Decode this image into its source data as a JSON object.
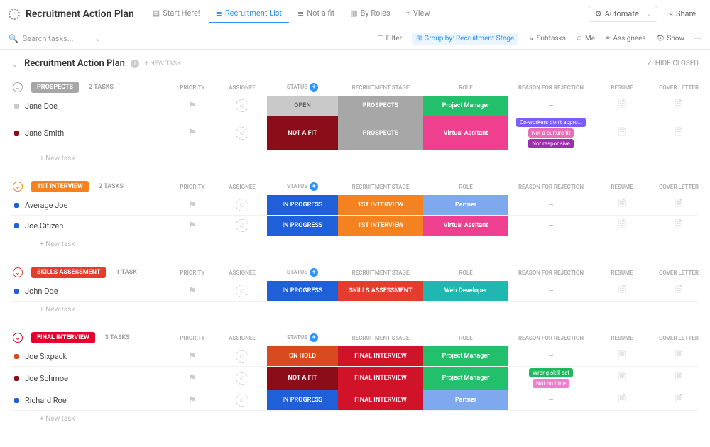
{
  "header": {
    "page_title": "Recruitment Action Plan",
    "views": [
      {
        "label": "Start Here!",
        "icon": "▤",
        "active": false
      },
      {
        "label": "Recruitment List",
        "icon": "≣",
        "active": true
      },
      {
        "label": "Not a fit",
        "icon": "≣",
        "active": false
      },
      {
        "label": "By Roles",
        "icon": "▥",
        "active": false
      },
      {
        "label": "View",
        "icon": "+",
        "active": false
      }
    ],
    "automate": "Automate",
    "share": "Share"
  },
  "toolbar": {
    "search_placeholder": "Search tasks...",
    "filter": "Filter",
    "group_by": "Group by: Recruitment Stage",
    "subtasks": "Subtasks",
    "me": "Me",
    "assignees": "Assignees",
    "show": "Show"
  },
  "list": {
    "title": "Recruitment Action Plan",
    "new_task": "+ NEW TASK",
    "hide_closed": "HIDE CLOSED"
  },
  "columns": {
    "priority": "PRIORITY",
    "assignee": "ASSIGNEE",
    "status": "STATUS",
    "stage": "RECRUITMENT STAGE",
    "role": "ROLE",
    "reason": "REASON FOR REJECTION",
    "resume": "RESUME",
    "cover": "COVER LETTER"
  },
  "colors": {
    "prospects": "#a7a7a7",
    "interview1": "#f58220",
    "skills": "#e43c2f",
    "final": "#e4002b",
    "open_bg": "#c9c9c9",
    "open_text": "#5c5c5c",
    "notfit": "#8c0d1a",
    "prospects_cell": "#a7a7a7",
    "pm": "#22c06b",
    "va": "#ef3f8f",
    "partner": "#7fa9ef",
    "webdev": "#1fb8b0",
    "inprogress": "#1f5fd8",
    "onhold": "#d84a1f",
    "interview1_cell": "#f58220",
    "skills_cell": "#e43c2f",
    "final_cell": "#d1132a",
    "tag_purple": "#7c5cff",
    "tag_pink": "#e86fb5",
    "tag_magenta": "#9b2fae",
    "tag_green": "#1fb85f",
    "tag_pink2": "#f27ed0"
  },
  "groups": [
    {
      "name": "PROSPECTS",
      "color_key": "prospects",
      "collapse_color": "#a7a7a7",
      "count": "2 TASKS",
      "tasks": [
        {
          "name": "Jane Doe",
          "dot": "#c9c9c9",
          "status": {
            "label": "OPEN",
            "bg": "open_bg",
            "text": "open_text"
          },
          "stage": {
            "label": "PROSPECTS",
            "bg": "prospects_cell"
          },
          "role": {
            "label": "Project Manager",
            "bg": "pm"
          },
          "reason": "dash"
        },
        {
          "name": "Jane Smith",
          "dot": "#8c0d1a",
          "status": {
            "label": "NOT A FIT",
            "bg": "notfit"
          },
          "stage": {
            "label": "PROSPECTS",
            "bg": "prospects_cell"
          },
          "role": {
            "label": "Virtual Assitant",
            "bg": "va"
          },
          "reason": [
            {
              "label": "Co-workers don't appro...",
              "c": "tag_purple"
            },
            {
              "label": "Not a culture fit",
              "c": "tag_pink"
            },
            {
              "label": "Not responsive",
              "c": "tag_magenta"
            }
          ]
        }
      ]
    },
    {
      "name": "1ST INTERVIEW",
      "color_key": "interview1",
      "collapse_color": "#f58220",
      "count": "2 TASKS",
      "tasks": [
        {
          "name": "Average Joe",
          "dot": "#1f5fd8",
          "status": {
            "label": "IN PROGRESS",
            "bg": "inprogress"
          },
          "stage": {
            "label": "1ST INTERVIEW",
            "bg": "interview1_cell"
          },
          "role": {
            "label": "Partner",
            "bg": "partner"
          },
          "reason": "dash"
        },
        {
          "name": "Joe Citizen",
          "dot": "#1f5fd8",
          "status": {
            "label": "IN PROGRESS",
            "bg": "inprogress"
          },
          "stage": {
            "label": "1ST INTERVIEW",
            "bg": "interview1_cell"
          },
          "role": {
            "label": "Virtual Assitant",
            "bg": "va"
          },
          "reason": "dash"
        }
      ]
    },
    {
      "name": "SKILLS ASSESSMENT",
      "color_key": "skills",
      "collapse_color": "#e43c2f",
      "count": "1 TASK",
      "tasks": [
        {
          "name": "John Doe",
          "dot": "#1f5fd8",
          "status": {
            "label": "IN PROGRESS",
            "bg": "inprogress"
          },
          "stage": {
            "label": "SKILLS ASSESSMENT",
            "bg": "skills_cell"
          },
          "role": {
            "label": "Web Developer",
            "bg": "webdev"
          },
          "reason": "dash"
        }
      ]
    },
    {
      "name": "FINAL INTERVIEW",
      "color_key": "final",
      "collapse_color": "#e4002b",
      "count": "3 TASKS",
      "tasks": [
        {
          "name": "Joe Sixpack",
          "dot": "#d84a1f",
          "status": {
            "label": "ON HOLD",
            "bg": "onhold"
          },
          "stage": {
            "label": "FINAL INTERVIEW",
            "bg": "final_cell"
          },
          "role": {
            "label": "Project Manager",
            "bg": "pm"
          },
          "reason": "dash"
        },
        {
          "name": "Joe Schmoe",
          "dot": "#8c0d1a",
          "status": {
            "label": "NOT A FIT",
            "bg": "notfit"
          },
          "stage": {
            "label": "FINAL INTERVIEW",
            "bg": "final_cell"
          },
          "role": {
            "label": "Project Manager",
            "bg": "pm"
          },
          "reason": [
            {
              "label": "Wrong skill set",
              "c": "tag_green"
            },
            {
              "label": "Not on time",
              "c": "tag_pink2"
            }
          ]
        },
        {
          "name": "Richard Roe",
          "dot": "#1f5fd8",
          "status": {
            "label": "IN PROGRESS",
            "bg": "inprogress"
          },
          "stage": {
            "label": "FINAL INTERVIEW",
            "bg": "final_cell"
          },
          "role": {
            "label": "Partner",
            "bg": "partner"
          },
          "reason": "dash"
        }
      ]
    }
  ],
  "new_task_label": "+ New task"
}
